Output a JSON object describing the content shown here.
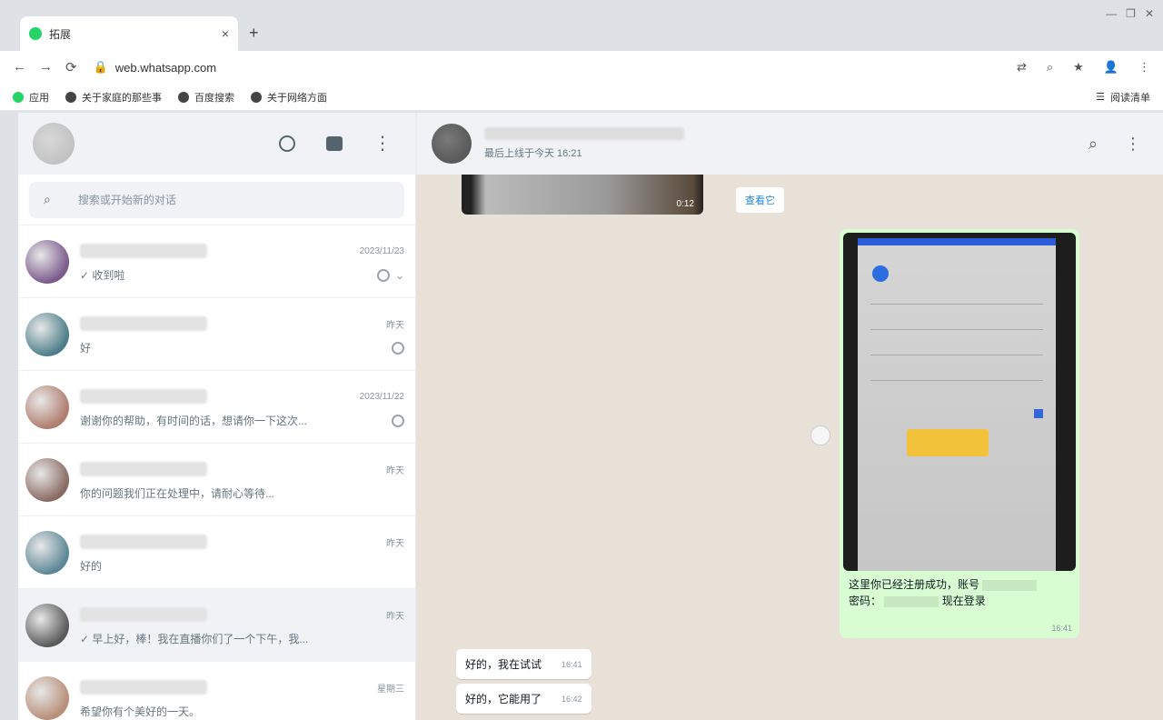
{
  "browser": {
    "tab_title": "拓展",
    "tab_close": "×",
    "new_tab": "+",
    "window_controls": [
      "—",
      "❐",
      "✕"
    ],
    "url": "web.whatsapp.com",
    "bookmarks": [
      "应用",
      "关于家庭的那些事",
      "百度搜索",
      "关于网络方面"
    ],
    "bookmarks_right": "阅读清单"
  },
  "sidebar": {
    "search_placeholder": "搜索或开始新的对话",
    "chats": [
      {
        "time": "2023/11/23",
        "preview": "✓ 收到啦",
        "active": false,
        "muted": true,
        "chevron": true,
        "avatar": "#7b5a8c"
      },
      {
        "time": "昨天",
        "preview": "好",
        "active": false,
        "muted": true,
        "chevron": false,
        "avatar": "#4d7f8a"
      },
      {
        "time": "2023/11/22",
        "preview": "谢谢你的帮助，有时间的话，想请你一下这次...",
        "active": false,
        "muted": true,
        "chevron": false,
        "avatar": "#b07d6e"
      },
      {
        "time": "昨天",
        "preview": "你的问题我们正在处理中，请耐心等待...",
        "active": false,
        "muted": false,
        "chevron": false,
        "avatar": "#8a6b63"
      },
      {
        "time": "昨天",
        "preview": "好的",
        "active": false,
        "muted": false,
        "chevron": false,
        "avatar": "#5d8796"
      },
      {
        "time": "昨天",
        "preview": "✓ 早上好，棒！我在直播你们了一个下午，我...",
        "active": true,
        "muted": false,
        "chevron": false,
        "avatar": "#5a5a5a"
      },
      {
        "time": "星期三",
        "preview": "希望你有个美好的一天。",
        "active": false,
        "muted": false,
        "chevron": false,
        "avatar": "#b88f78"
      }
    ]
  },
  "conversation": {
    "status": "最后上线于今天 16:21",
    "video_duration": "0:12",
    "reply_badge": "查看它",
    "image_caption_part1": "这里你已经注册成功，账号",
    "image_caption_part2": "密码：",
    "image_caption_part3": "现在登录",
    "image_time": "16:41",
    "received": [
      {
        "text": "好的，我在试试",
        "time": "16:41"
      },
      {
        "text": "好的，它能用了",
        "time": "16:42"
      }
    ]
  }
}
